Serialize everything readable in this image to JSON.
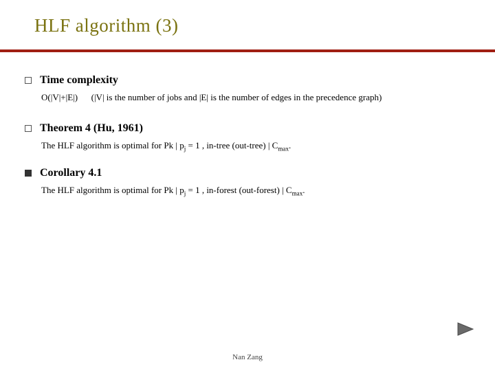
{
  "title": "HLF algorithm (3)",
  "items": [
    {
      "bullet": "hollow",
      "lead": "Time complexity",
      "sub_prefix": "O(|V|+|E|)",
      "sub_rest": "(|V| is the number of jobs and |E| is the number of edges in the precedence graph)"
    },
    {
      "bullet": "hollow",
      "lead": "Theorem 4 (Hu, 1961)",
      "sub_sentence_a": "The HLF algorithm is optimal for Pk | p",
      "sub_sentence_b": "j",
      "sub_sentence_c": " = 1 , in-tree (out-tree) | C",
      "sub_sentence_d": "max",
      "sub_sentence_e": "."
    },
    {
      "bullet": "solid",
      "lead": "Corollary 4.1",
      "sub_sentence_a": "The HLF algorithm is optimal for Pk | p",
      "sub_sentence_b": "j",
      "sub_sentence_c": " = 1 , in-forest (out-forest) | C",
      "sub_sentence_d": "max",
      "sub_sentence_e": "."
    }
  ],
  "footer": "Nan Zang",
  "icons": {
    "next": "next-arrow"
  }
}
